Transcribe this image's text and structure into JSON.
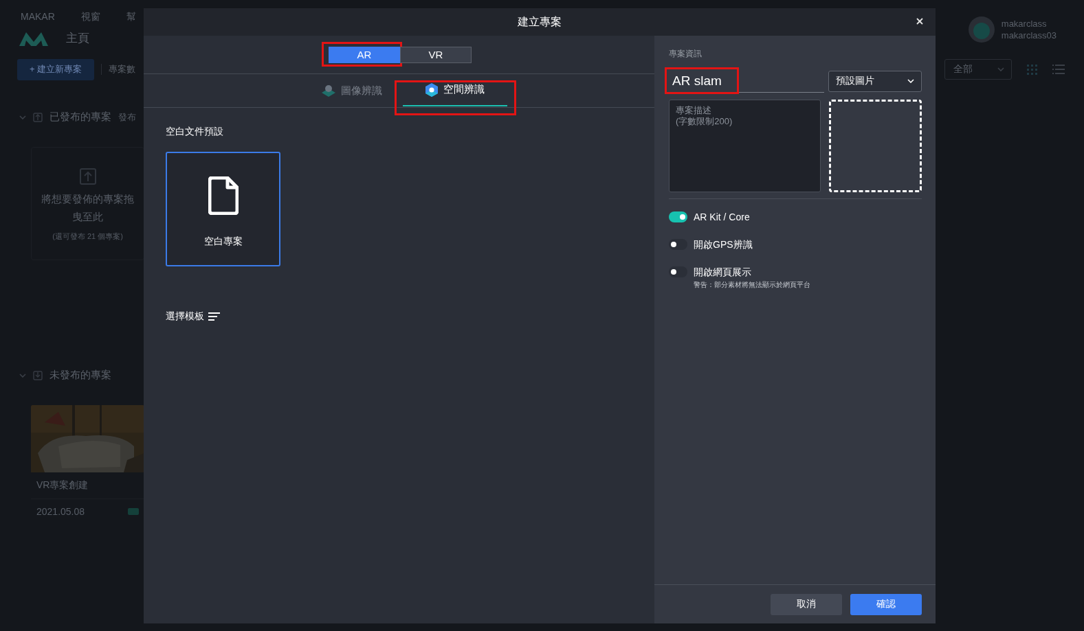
{
  "app": {
    "menu": [
      "MAKAR",
      "視窗",
      "幫"
    ],
    "page_title": "主頁",
    "new_project_button": "+ 建立新專案",
    "project_count_label": "專案數",
    "user": {
      "name": "makarclass",
      "id": "makarclass03"
    },
    "filter": {
      "value": "全部"
    },
    "published": {
      "title": "已發布的專案",
      "subtitle": "發布",
      "dropzone": {
        "text": "將想要發佈的專案拖曳至此",
        "note": "(還可發布 21 個專案)"
      }
    },
    "unpublished": {
      "title": "未發布的專案",
      "projects": [
        {
          "title": "VR專案創建",
          "date": "2021.05.08",
          "kind": "picture"
        }
      ]
    }
  },
  "dialog": {
    "title": "建立專案",
    "mode_tabs": [
      {
        "label": "AR",
        "selected": true,
        "highlighted": true
      },
      {
        "label": "VR",
        "selected": false,
        "highlighted": false
      }
    ],
    "recognition_tabs": [
      {
        "label": "圖像辨識",
        "selected": false,
        "highlighted": false
      },
      {
        "label": "空間辨識",
        "kind": "space",
        "selected": true,
        "highlighted": true
      }
    ],
    "blank_section": {
      "title": "空白文件預設",
      "items": [
        {
          "label": "空白專案",
          "selected": true
        }
      ]
    },
    "template_section": {
      "title": "選擇模板"
    },
    "info": {
      "title": "專案資訊",
      "name": {
        "value": "AR slam",
        "highlighted": true
      },
      "cover_select": {
        "value": "預設圖片"
      },
      "description": {
        "placeholder": "專案描述\n(字數限制200)"
      },
      "options": [
        {
          "label": "AR Kit / Core",
          "on": true
        },
        {
          "label": "開啟GPS辨識",
          "on": false
        },
        {
          "label": "開啟網頁展示",
          "on": false,
          "note": "警告：部分素材將無法顯示於網頁平台"
        }
      ]
    },
    "buttons": [
      {
        "label": "取消",
        "kind": "secondary"
      },
      {
        "label": "確認",
        "kind": "primary"
      }
    ]
  }
}
